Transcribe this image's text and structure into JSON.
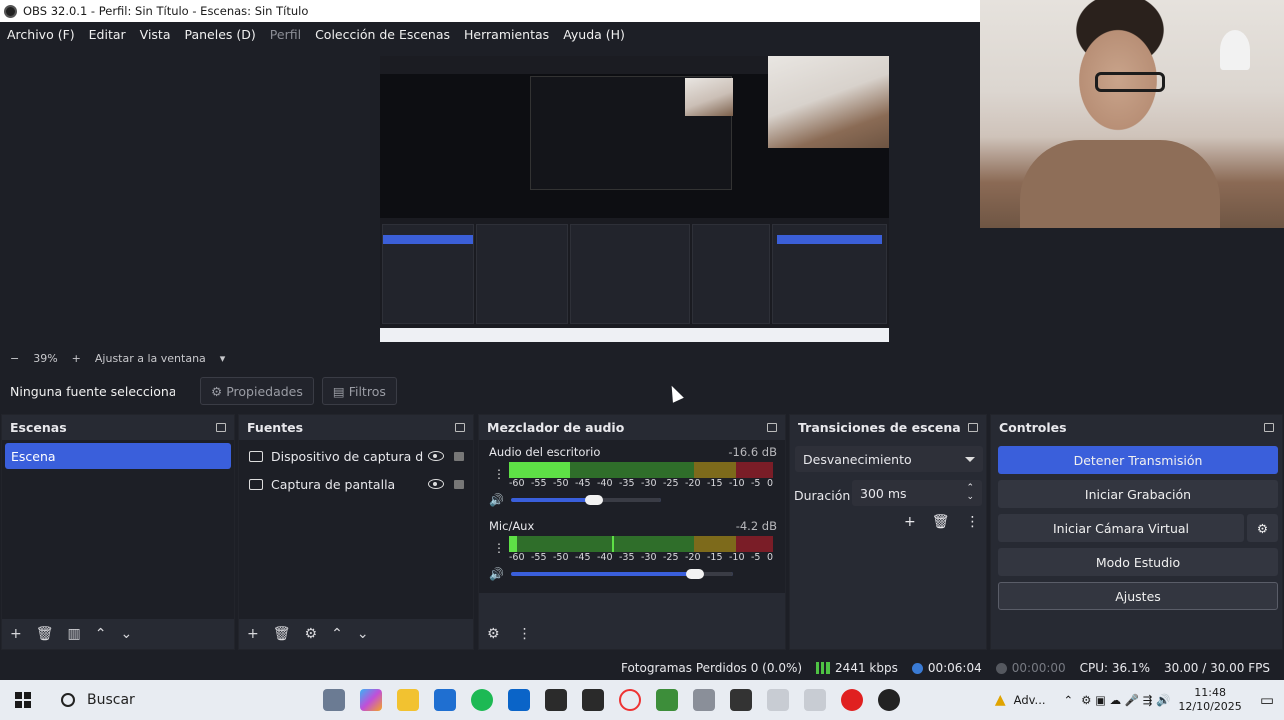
{
  "window": {
    "title": "OBS 32.0.1 - Perfil: Sin Título - Escenas: Sin Título"
  },
  "menu": [
    "Archivo (F)",
    "Editar",
    "Vista",
    "Paneles (D)",
    "Perfil",
    "Colección de Escenas",
    "Herramientas",
    "Ayuda (H)"
  ],
  "zoom": {
    "level": "39%",
    "fit": "Ajustar a la ventana"
  },
  "context": {
    "label": "Ninguna fuente seleccionada",
    "properties": "Propiedades",
    "filters": "Filtros"
  },
  "scenes": {
    "title": "Escenas",
    "items": [
      "Escena"
    ]
  },
  "sources": {
    "title": "Fuentes",
    "items": [
      "Dispositivo de captura de vídeo",
      "Captura de pantalla"
    ]
  },
  "mixer": {
    "title": "Mezclador de audio",
    "ticks": [
      "-60",
      "-55",
      "-50",
      "-45",
      "-40",
      "-35",
      "-30",
      "-25",
      "-20",
      "-15",
      "-10",
      "-5",
      "0"
    ],
    "channels": [
      {
        "name": "Audio del escritorio",
        "db": "-16.6 dB",
        "level": 0.23,
        "peak": 0.22,
        "volume": 0.55
      },
      {
        "name": "Mic/Aux",
        "db": "-4.2 dB",
        "level": 0.03,
        "peak": 0.39,
        "volume": 0.83
      }
    ]
  },
  "transitions": {
    "title": "Transiciones de escena",
    "selected": "Desvanecimiento",
    "duration_label": "Duración",
    "duration": "300 ms"
  },
  "controls": {
    "title": "Controles",
    "stop_stream": "Detener Transmisión",
    "start_recording": "Iniciar Grabación",
    "virtual_cam": "Iniciar Cámara Virtual",
    "studio_mode": "Modo Estudio",
    "settings": "Ajustes"
  },
  "status": {
    "dropped": "Fotogramas Perdidos 0 (0.0%)",
    "bitrate": "2441 kbps",
    "stream_time": "00:06:04",
    "record_time": "00:00:00",
    "cpu": "CPU: 36.1%",
    "fps": "30.00 / 30.00 FPS"
  },
  "taskbar": {
    "search": "Buscar",
    "weather": "Adv...",
    "time": "11:48",
    "date": "12/10/2025"
  },
  "colors": {
    "accent": "#3a5fdb",
    "meter_green": "#5ee046",
    "meter_yellow": "#7d6a1b",
    "meter_red": "#7a1d27"
  }
}
